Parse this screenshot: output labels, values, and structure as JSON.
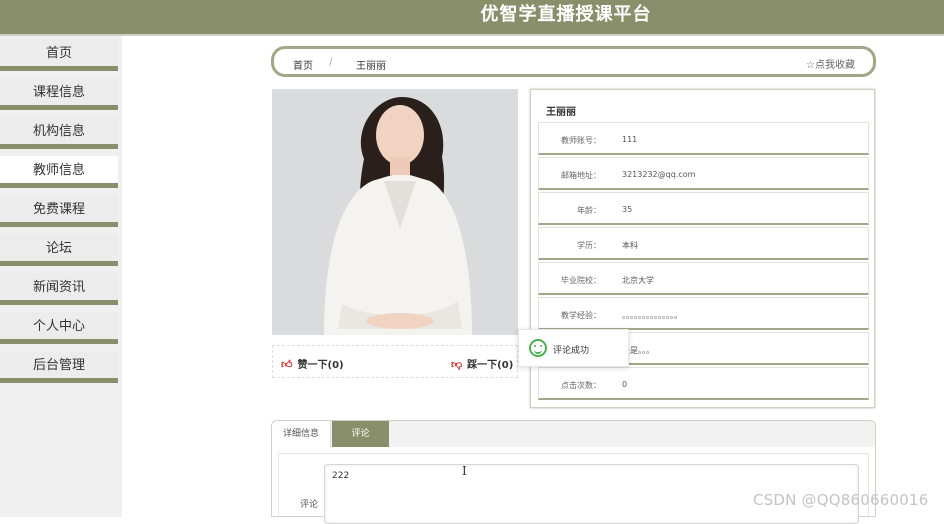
{
  "header": {
    "title": "优智学直播授课平台"
  },
  "sidebar": {
    "items": [
      {
        "label": "首页"
      },
      {
        "label": "课程信息"
      },
      {
        "label": "机构信息"
      },
      {
        "label": "教师信息"
      },
      {
        "label": "免费课程"
      },
      {
        "label": "论坛"
      },
      {
        "label": "新闻资讯"
      },
      {
        "label": "个人中心"
      },
      {
        "label": "后台管理"
      }
    ],
    "active": "教师信息"
  },
  "breadcrumb": {
    "home": "首页",
    "separator": "/",
    "current": "王丽丽",
    "favorite": "☆点我收藏"
  },
  "teacher": {
    "name": "王丽丽",
    "fields": [
      {
        "label": "教师账号：",
        "value": "111"
      },
      {
        "label": "邮箱地址：",
        "value": "3213232@qq.com"
      },
      {
        "label": "年龄：",
        "value": "35"
      },
      {
        "label": "学历：",
        "value": "本科"
      },
      {
        "label": "毕业院校：",
        "value": "北京大学"
      },
      {
        "label": "教学经验：",
        "value": "。。。。。。。。。。。。。。"
      },
      {
        "label": "",
        "value": "长是。。。"
      },
      {
        "label": "点击次数：",
        "value": "0"
      }
    ]
  },
  "votes": {
    "up": "赞一下(0)",
    "down": "踩一下(0)"
  },
  "toast": {
    "message": "评论成功"
  },
  "tabs": {
    "detail": "详细信息",
    "comment": "评论"
  },
  "comment": {
    "label": "评论",
    "value": "222"
  },
  "watermark": "CSDN @QQ860660016",
  "colors": {
    "brand": "#8a8f6b",
    "vote_icon": "#d9302b",
    "toast_icon": "#4caf50"
  },
  "icons": {
    "favorite": "star-outline-icon",
    "up": "thumb-up-icon",
    "down": "thumb-down-icon",
    "toast": "smile-icon",
    "cursor": "text-cursor-icon"
  }
}
